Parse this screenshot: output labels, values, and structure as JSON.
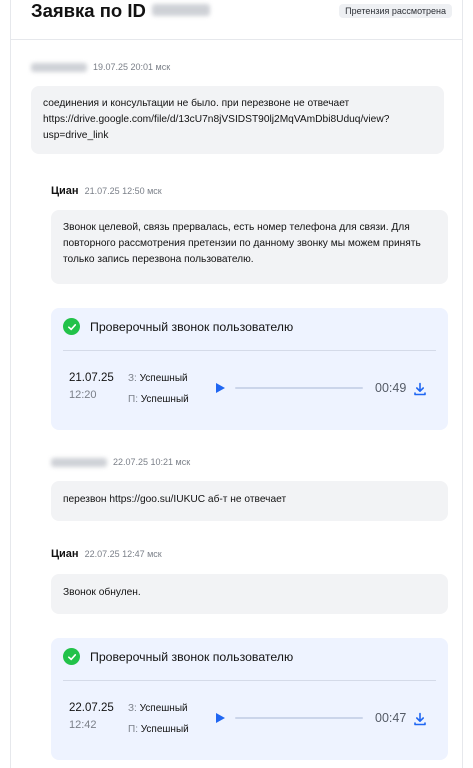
{
  "header": {
    "title": "Заявка по ID",
    "badge": "Претензия рассмотрена"
  },
  "messages": [
    {
      "date": "19.07.25 20:01 мск",
      "text": "соединения и консультации не было. при перезвоне не отвечает https://drive.google.com/file/d/13cU7n8jVSIDST90lj2MqVAmDbi8Uduq/view?usp=drive_link"
    },
    {
      "author": "Циан",
      "date": "21.07.25 12:50 мск",
      "text": "Звонок целевой, связь прервалась, есть номер телефона для связи. Для повторного рассмотрения претензии по данному звонку мы можем принять только запись перезвона пользователю."
    },
    {
      "date": "22.07.25 10:21 мск",
      "text": "перезвон https://goo.su/IUKUC аб-т не отвечает"
    },
    {
      "author": "Циан",
      "date": "22.07.25 12:47 мск",
      "text": "Звонок обнулен."
    }
  ],
  "calls": [
    {
      "title": "Проверочный звонок пользователю",
      "date": "21.07.25",
      "time": "12:20",
      "z_key": "З:",
      "z_val": "Успешный",
      "p_key": "П:",
      "p_val": "Успешный",
      "duration": "00:49",
      "progress": 0
    },
    {
      "title": "Проверочный звонок пользователю",
      "date": "22.07.25",
      "time": "12:42",
      "z_key": "З:",
      "z_val": "Успешный",
      "p_key": "П:",
      "p_val": "Успешный",
      "duration": "00:47",
      "progress": 0
    }
  ],
  "colors": {
    "accent": "#1f66f2",
    "success": "#22c24a",
    "bubble": "#f2f3f5",
    "card": "#eef3ff"
  },
  "icons": {
    "check": "check-circle-icon",
    "play": "play-icon",
    "download": "download-icon"
  }
}
